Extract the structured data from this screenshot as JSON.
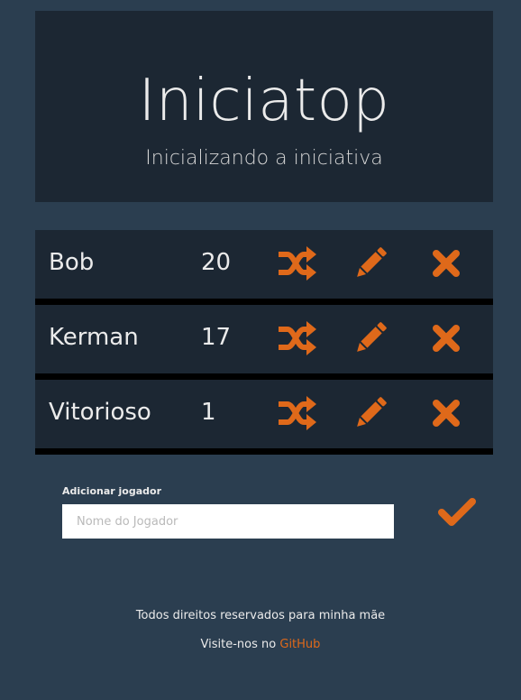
{
  "hero": {
    "title": "Iniciatop",
    "subtitle": "Inicializando a iniciativa"
  },
  "players": [
    {
      "name": "Bob",
      "initiative": "20"
    },
    {
      "name": "Kerman",
      "initiative": "17"
    },
    {
      "name": "Vitorioso",
      "initiative": "1"
    }
  ],
  "icons": {
    "shuffle": "random-icon",
    "edit": "pencil-icon",
    "remove": "close-icon",
    "confirm": "check-icon"
  },
  "add_player": {
    "label": "Adicionar jogador",
    "placeholder": "Nome do Jogador",
    "value": ""
  },
  "footer": {
    "rights": "Todos direitos reservados para minha mãe",
    "visit_prefix": "Visite-nos no",
    "link_text": "GitHub"
  },
  "colors": {
    "background": "#2b3e50",
    "panel": "#1c2733",
    "accent": "#df691a",
    "text": "#ebebeb"
  }
}
